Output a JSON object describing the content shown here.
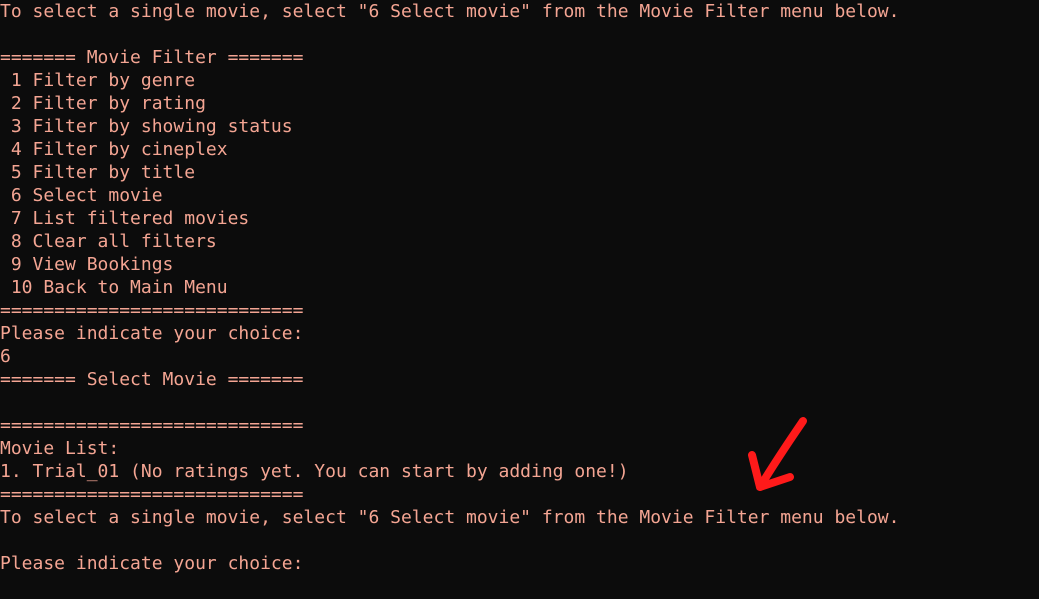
{
  "terminal": {
    "lines": [
      "To select a single movie, select \"6 Select movie\" from the Movie Filter menu below.",
      "",
      "======= Movie Filter =======",
      " 1 Filter by genre",
      " 2 Filter by rating",
      " 3 Filter by showing status",
      " 4 Filter by cineplex",
      " 5 Filter by title",
      " 6 Select movie",
      " 7 List filtered movies",
      " 8 Clear all filters",
      " 9 View Bookings",
      " 10 Back to Main Menu",
      "============================",
      "Please indicate your choice:",
      "6",
      "======= Select Movie =======",
      "",
      "============================",
      "Movie List:",
      "1. Trial_01 (No ratings yet. You can start by adding one!)",
      "============================",
      "To select a single movie, select \"6 Select movie\" from the Movie Filter menu below.",
      "",
      "Please indicate your choice:"
    ]
  },
  "colors": {
    "background": "#0c0c0c",
    "text": "#f4a593",
    "annotation_arrow": "#ff1a1a"
  },
  "icons": {
    "annotation": "red-arrow-annotation-icon"
  }
}
